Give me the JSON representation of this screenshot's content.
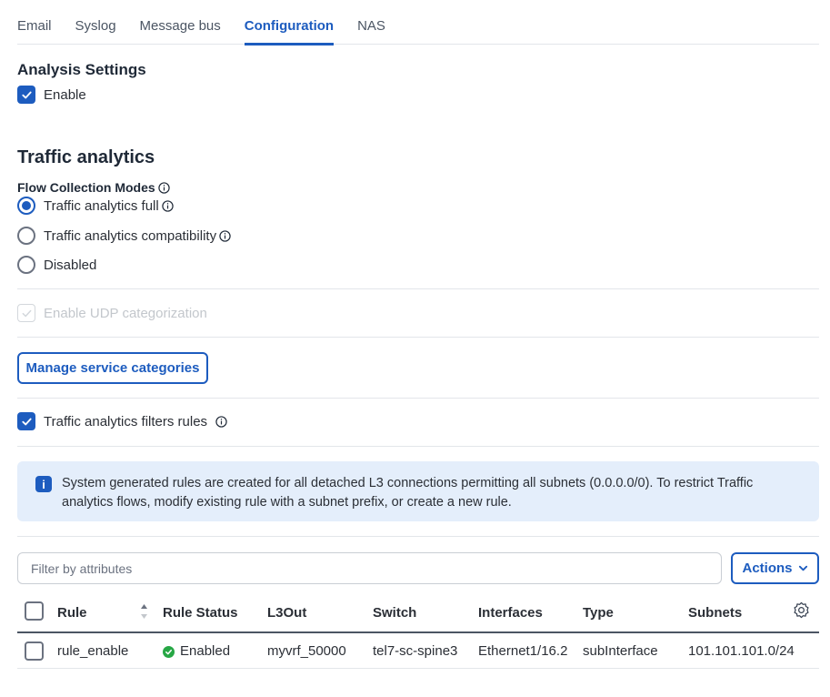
{
  "tabs": [
    {
      "label": "Email"
    },
    {
      "label": "Syslog"
    },
    {
      "label": "Message bus"
    },
    {
      "label": "Configuration"
    },
    {
      "label": "NAS"
    }
  ],
  "active_tab": "Configuration",
  "analysis": {
    "heading": "Analysis Settings",
    "enable_label": "Enable",
    "enabled": true
  },
  "traffic": {
    "heading": "Traffic analytics",
    "modes_label": "Flow Collection Modes",
    "modes": [
      {
        "label": "Traffic analytics full",
        "selected": true,
        "has_info": true
      },
      {
        "label": "Traffic analytics compatibility",
        "selected": false,
        "has_info": true
      },
      {
        "label": "Disabled",
        "selected": false,
        "has_info": false
      }
    ],
    "udp_label": "Enable UDP categorization",
    "manage_button": "Manage service categories",
    "filters_label": "Traffic analytics filters rules",
    "filters_enabled": true
  },
  "banner": {
    "icon": "info-icon",
    "text": "System generated rules are created for all detached L3 connections permitting all subnets (0.0.0.0/0). To restrict Traffic analytics flows, modify existing rule with a subnet prefix, or create a new rule."
  },
  "filter": {
    "placeholder": "Filter by attributes"
  },
  "actions_label": "Actions",
  "table": {
    "columns": [
      "Rule",
      "Rule Status",
      "L3Out",
      "Switch",
      "Interfaces",
      "Type",
      "Subnets"
    ],
    "rows": [
      {
        "rule": "rule_enable",
        "status": "Enabled",
        "l3out": "myvrf_50000",
        "switch": "tel7-sc-spine3",
        "interfaces": "Ethernet1/16.2",
        "type": "subInterface",
        "subnets": "101.101.101.0/24"
      }
    ]
  },
  "colors": {
    "accent": "#1d5cbf",
    "success": "#27a745",
    "banner_bg": "#e4eefb"
  }
}
